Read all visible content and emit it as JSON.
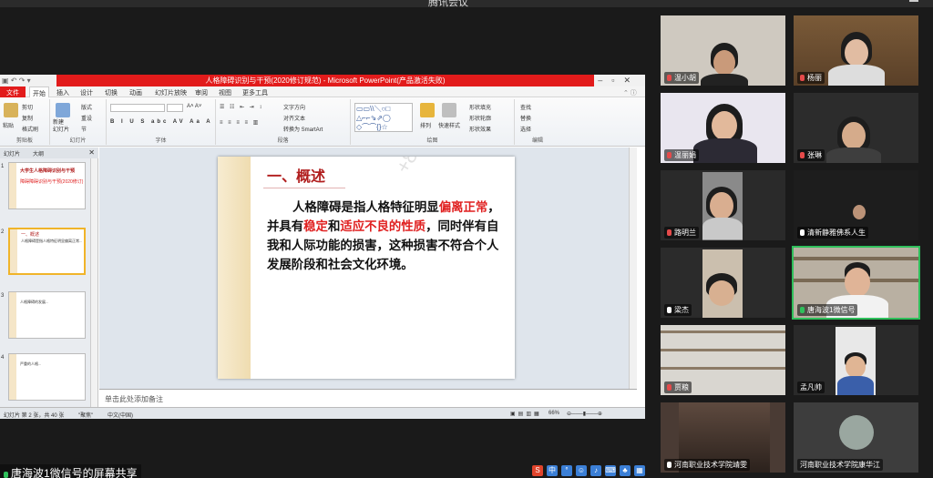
{
  "meeting": {
    "title": "腾讯会议",
    "share_label": "唐海波1微信号的屏幕共享"
  },
  "ppt": {
    "window_title": "人格障碍识别与干预(2020修订规范) - Microsoft PowerPoint(产品激活失败)",
    "tabs": [
      "文件",
      "开始",
      "插入",
      "设计",
      "切换",
      "动画",
      "幻灯片放映",
      "审阅",
      "视图",
      "更多工具"
    ],
    "active_tab": "开始",
    "ribbon_groups": [
      "剪贴板",
      "幻灯片",
      "字体",
      "段落",
      "绘图",
      "编辑"
    ],
    "ribbon_items": {
      "paste": "粘贴",
      "cut": "剪切",
      "copy": "复制",
      "format_painter": "格式刷",
      "new_slide": "新建\n幻灯片",
      "layout": "版式",
      "reset": "重设",
      "section": "节",
      "text_direction": "文字方向",
      "align_text": "对齐文本",
      "smartart": "转换为 SmartArt",
      "arrange": "排列",
      "quick_styles": "快速样式",
      "shape_fill": "形状填充",
      "shape_outline": "形状轮廓",
      "shape_effects": "形状效果",
      "find": "查找",
      "replace": "替换",
      "select": "选择"
    },
    "panel_tabs": [
      "幻灯片",
      "大纲"
    ],
    "thumbnails": [
      {
        "num": "1",
        "title": "大学生人格障碍识别与干预",
        "sub": "障碍障碍识别与干预(2020修订)"
      },
      {
        "num": "2",
        "title": "一、概述",
        "sub": "人格障碍是指人格特征明显偏离正常..."
      },
      {
        "num": "3",
        "title": "",
        "sub": "人格障碍的发展..."
      },
      {
        "num": "4",
        "title": "",
        "sub": "严重的人格..."
      }
    ],
    "slide": {
      "heading": "一、概述",
      "body_parts": [
        {
          "text": "人格障碍是指人格特征明显",
          "red": false
        },
        {
          "text": "偏离正常",
          "red": true
        },
        {
          "text": "，并具有",
          "red": false
        },
        {
          "text": "稳定",
          "red": true
        },
        {
          "text": "和",
          "red": false
        },
        {
          "text": "适应不良的性质",
          "red": true
        },
        {
          "text": "，同时伴有自我和人际功能的损害，这种损害不符合个人发展阶段和社会文化环境。",
          "red": false
        }
      ],
      "watermark": "+861789...1128"
    },
    "notes_placeholder": "单击此处添加备注",
    "status": {
      "slide_info": "幻灯片 第 2 张，共 40 张",
      "theme": "\"聚焦\"",
      "language": "中文(中国)",
      "zoom": "66%"
    }
  },
  "participants": [
    {
      "name": "温小胡",
      "mic": "muted"
    },
    {
      "name": "杨丽",
      "mic": "muted"
    },
    {
      "name": "温丽娟",
      "mic": "muted"
    },
    {
      "name": "张琳",
      "mic": "muted"
    },
    {
      "name": "路明兰",
      "mic": "muted"
    },
    {
      "name": "清新静雅佛系人生",
      "mic": "on"
    },
    {
      "name": "梁杰",
      "mic": "on"
    },
    {
      "name": "唐海波1微信号",
      "mic": "green"
    },
    {
      "name": "贾粮",
      "mic": "muted"
    },
    {
      "name": "孟凡帅",
      "mic": "none"
    },
    {
      "name": "河南职业技术学院靖雯",
      "mic": "on"
    },
    {
      "name": "河南职业技术学院康华江",
      "mic": "none"
    }
  ],
  "colors": {
    "ppt_red": "#e21b1b",
    "slide_heading": "#b11e1e",
    "slide_emphasis": "#e02020",
    "active_speaker": "#2fbf5b"
  }
}
